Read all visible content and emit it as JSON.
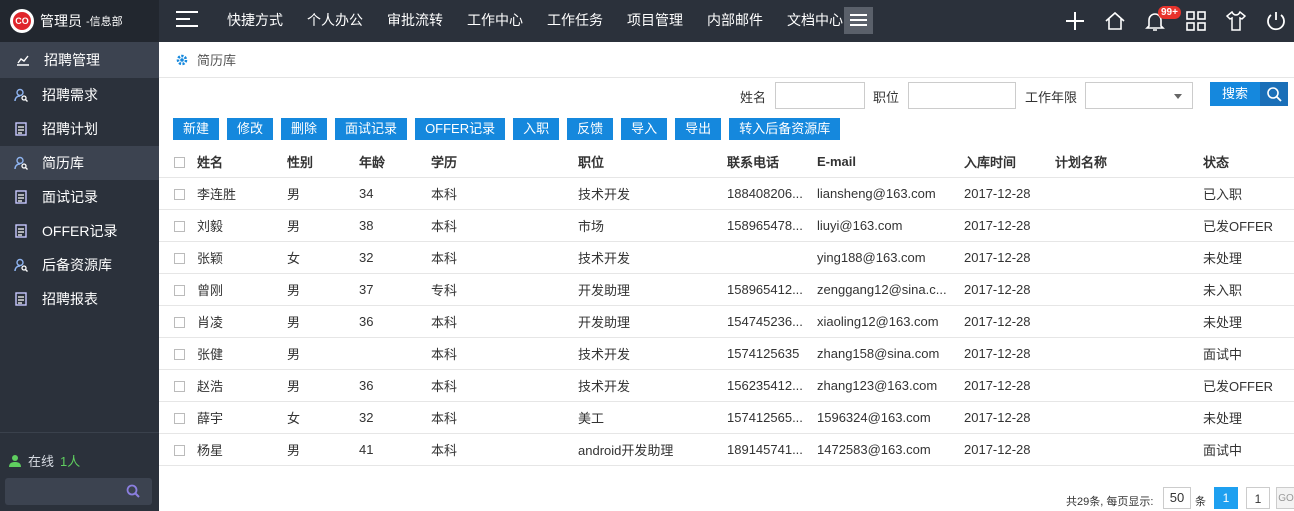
{
  "app": {
    "user": "管理员",
    "dept": "-信息部",
    "logo_text": "CO",
    "notify_badge": "99+"
  },
  "topnav": [
    "快捷方式",
    "个人办公",
    "审批流转",
    "工作中心",
    "工作任务",
    "项目管理",
    "内部邮件",
    "文档中心"
  ],
  "sidebar": {
    "title": "招聘管理",
    "items": [
      {
        "label": "招聘需求",
        "icon": "user-search-icon"
      },
      {
        "label": "招聘计划",
        "icon": "document-icon"
      },
      {
        "label": "简历库",
        "icon": "user-search-icon",
        "active": true
      },
      {
        "label": "面试记录",
        "icon": "document-icon"
      },
      {
        "label": "OFFER记录",
        "icon": "document-icon"
      },
      {
        "label": "后备资源库",
        "icon": "user-search-icon"
      },
      {
        "label": "招聘报表",
        "icon": "document-icon"
      }
    ],
    "online_label": "在线",
    "online_count": "1人"
  },
  "breadcrumb": "简历库",
  "filter": {
    "name_label": "姓名",
    "position_label": "职位",
    "years_label": "工作年限",
    "search_button": "搜索"
  },
  "toolbar": [
    "新建",
    "修改",
    "删除",
    "面试记录",
    "OFFER记录",
    "入职",
    "反馈",
    "导入",
    "导出",
    "转入后备资源库"
  ],
  "table": {
    "columns": [
      "姓名",
      "性别",
      "年龄",
      "学历",
      "职位",
      "联系电话",
      "E-mail",
      "入库时间",
      "计划名称",
      "状态"
    ],
    "rows": [
      [
        "李连胜",
        "男",
        "34",
        "本科",
        "技术开发",
        "188408206...",
        "liansheng@163.com",
        "2017-12-28",
        "",
        "已入职"
      ],
      [
        "刘毅",
        "男",
        "38",
        "本科",
        "市场",
        "158965478...",
        "liuyi@163.com",
        "2017-12-28",
        "",
        "已发OFFER"
      ],
      [
        "张颖",
        "女",
        "32",
        "本科",
        "技术开发",
        "",
        "ying188@163.com",
        "2017-12-28",
        "",
        "未处理"
      ],
      [
        "曾刚",
        "男",
        "37",
        "专科",
        "开发助理",
        "158965412...",
        "zenggang12@sina.c...",
        "2017-12-28",
        "",
        "未入职"
      ],
      [
        "肖凌",
        "男",
        "36",
        "本科",
        "开发助理",
        "154745236...",
        "xiaoling12@163.com",
        "2017-12-28",
        "",
        "未处理"
      ],
      [
        "张健",
        "男",
        "",
        "本科",
        "技术开发",
        "1574125635",
        "zhang158@sina.com",
        "2017-12-28",
        "",
        "面试中"
      ],
      [
        "赵浩",
        "男",
        "36",
        "本科",
        "技术开发",
        "156235412...",
        "zhang123@163.com",
        "2017-12-28",
        "",
        "已发OFFER"
      ],
      [
        "薛宇",
        "女",
        "32",
        "本科",
        "美工",
        "157412565...",
        "1596324@163.com",
        "2017-12-28",
        "",
        "未处理"
      ],
      [
        "杨星",
        "男",
        "41",
        "本科",
        "android开发助理",
        "189145741...",
        "1472583@163.com",
        "2017-12-28",
        "",
        "面试中"
      ]
    ]
  },
  "pager": {
    "total": "共29条, 每页显示:",
    "page_size": "50",
    "unit": "条",
    "current": "1",
    "page_input": "1",
    "go": "GO"
  },
  "colors": {
    "topbar": "#2b313b",
    "accent": "#1588dd"
  }
}
